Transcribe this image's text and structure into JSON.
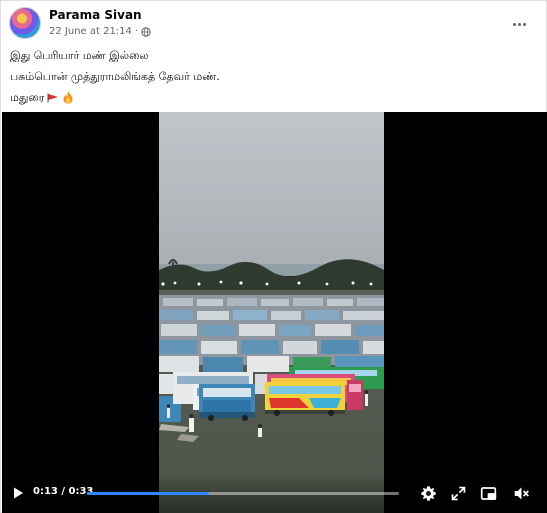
{
  "post": {
    "author": "Parama Sivan",
    "timestamp": "22 June at 21:14",
    "separator": "·",
    "audience_icon": "globe-icon",
    "menu_icon": "more-options-icon"
  },
  "caption": {
    "line1": "இது பெரியார் மண் இல்லை",
    "line2": "பசும்பொன் முத்துராமலிங்கத் தேவர் மண்.",
    "line3": "மதுரை",
    "line3_emojis": [
      "flag-icon",
      "fire-icon"
    ]
  },
  "video": {
    "current_time": "0:13",
    "duration": "0:33",
    "time_display": "0:13 / 0:33",
    "progress": 0.39,
    "controls": [
      "play-icon",
      "settings-gear-icon",
      "fullscreen-icon",
      "picture-in-picture-icon",
      "mute-icon"
    ],
    "colors": {
      "progress_fill": "#2d88ff",
      "flag_red": "#e0352b"
    }
  }
}
